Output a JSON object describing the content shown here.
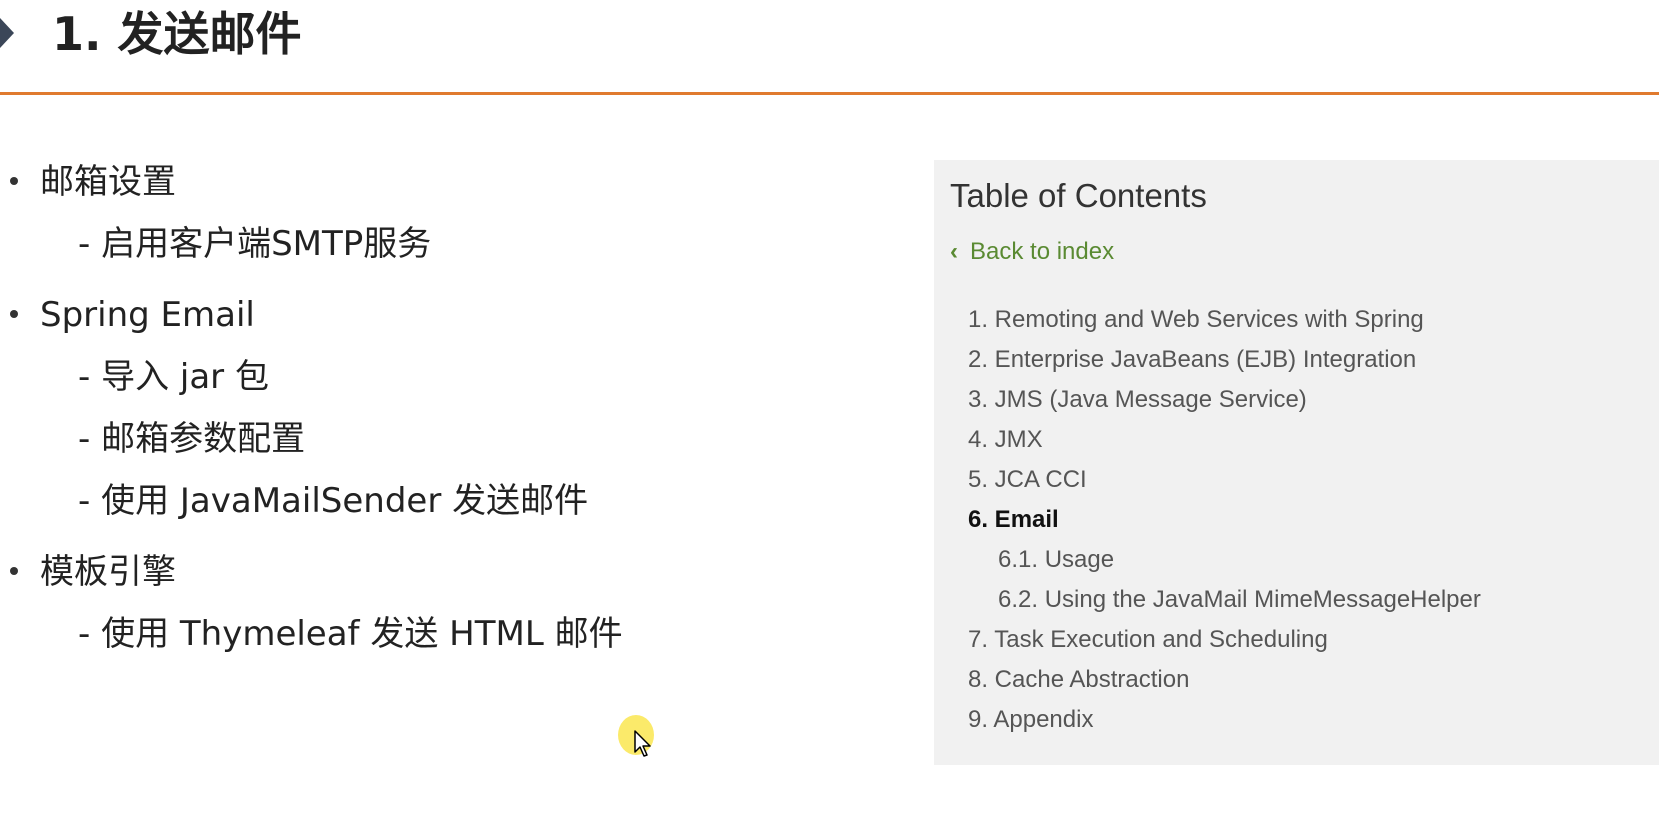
{
  "title": "1. 发送邮件",
  "bullets": [
    {
      "label": "邮箱设置",
      "subs": [
        "- 启用客户端SMTP服务"
      ]
    },
    {
      "label": "Spring Email",
      "subs": [
        "-  导入 jar 包",
        "-  邮箱参数配置",
        "-  使用 JavaMailSender 发送邮件"
      ]
    },
    {
      "label": "模板引擎",
      "subs": [
        "- 使用 Thymeleaf 发送 HTML 邮件"
      ]
    }
  ],
  "toc": {
    "heading": "Table of Contents",
    "back": "Back to index",
    "items": [
      "1. Remoting and Web Services with Spring",
      "2. Enterprise JavaBeans (EJB) Integration",
      "3. JMS (Java Message Service)",
      "4. JMX",
      "5. JCA CCI",
      "6. Email",
      "6.1. Usage",
      "6.2. Using the JavaMail MimeMessageHelper",
      "7. Task Execution and Scheduling",
      "8. Cache Abstraction",
      "9. Appendix"
    ]
  },
  "colors": {
    "accent_rule": "#e07a2e",
    "toc_background": "#f1f1f1",
    "back_link": "#5a8a32"
  },
  "icons": {
    "title_marker": "triangle-right-icon",
    "back": "chevron-left-icon",
    "cursor": "mouse-pointer-icon"
  }
}
